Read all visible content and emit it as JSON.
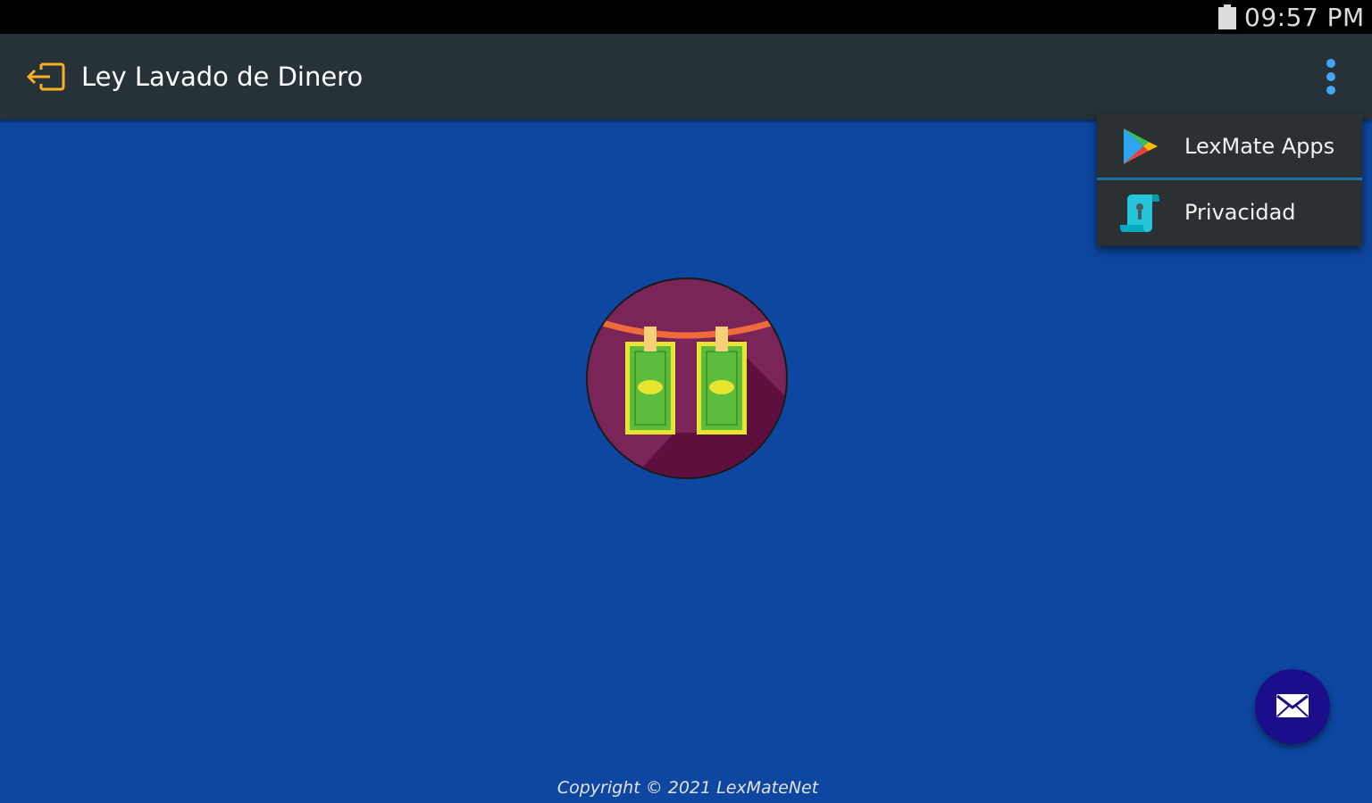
{
  "status_bar": {
    "time": "09:57 PM",
    "battery_icon": "battery-full-icon"
  },
  "app_bar": {
    "title": "Ley Lavado de Dinero",
    "exit_icon": "exit-icon",
    "overflow_icon": "more-vert-icon"
  },
  "menu": {
    "items": [
      {
        "label": "LexMate Apps",
        "icon": "google-play-icon"
      },
      {
        "label": "Privacidad",
        "icon": "scroll-document-icon"
      }
    ]
  },
  "main": {
    "logo_icon": "money-laundering-logo-icon",
    "fab_icon": "email-icon",
    "copyright": "Copyright © 2021 LexMateNet"
  },
  "colors": {
    "background": "#0d47a1",
    "app_bar": "#263238",
    "menu": "#2b3033",
    "fab": "#1a0e8a",
    "exit_icon": "#f5b024",
    "overflow_dots": "#42a5f5"
  }
}
